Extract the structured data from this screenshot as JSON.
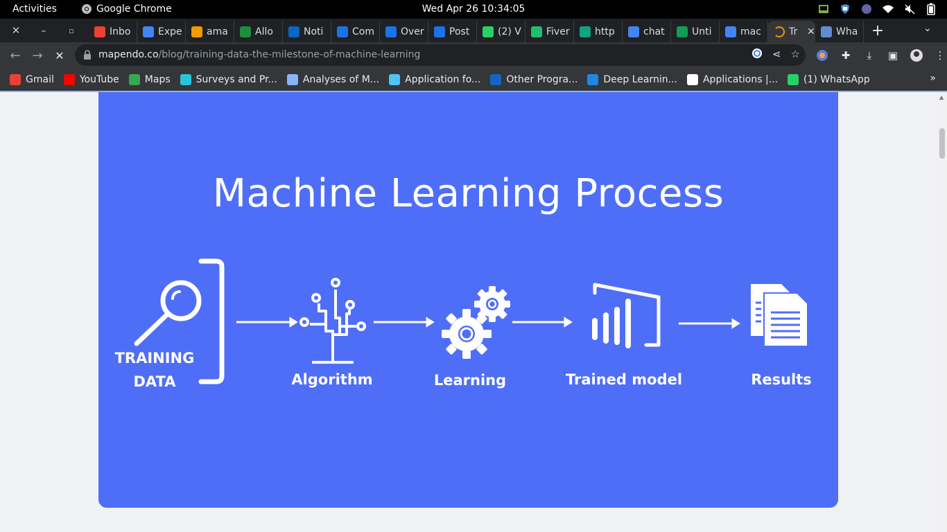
{
  "system": {
    "activities": "Activities",
    "app_name": "Google Chrome",
    "clock": "Wed Apr 26  10:34:05"
  },
  "tabs": [
    {
      "title": "Inbo",
      "icon": "gmail-icon",
      "color": "#ea4335"
    },
    {
      "title": "Expe",
      "icon": "gear-dots-icon",
      "color": "#4285f4"
    },
    {
      "title": "ama",
      "icon": "infinity-icon",
      "color": "#f29900"
    },
    {
      "title": "Allo",
      "icon": "chat-icon",
      "color": "#1e8e3e"
    },
    {
      "title": "Noti",
      "icon": "linkedin-icon",
      "color": "#0a66c2"
    },
    {
      "title": "Com",
      "icon": "play-icon",
      "color": "#1a73e8"
    },
    {
      "title": "Over",
      "icon": "play-icon",
      "color": "#1a73e8"
    },
    {
      "title": "Post",
      "icon": "play-icon",
      "color": "#1a73e8"
    },
    {
      "title": "(2) V",
      "icon": "whatsapp-icon",
      "color": "#25d366"
    },
    {
      "title": "Fiver",
      "icon": "fiverr-icon",
      "color": "#1dbf73"
    },
    {
      "title": "http",
      "icon": "openai-icon",
      "color": "#10a37f"
    },
    {
      "title": "chat",
      "icon": "google-icon",
      "color": "#4285f4"
    },
    {
      "title": "Unti",
      "icon": "sheets-icon",
      "color": "#0f9d58"
    },
    {
      "title": "mac",
      "icon": "google-icon",
      "color": "#4285f4"
    },
    {
      "title": "Tr",
      "icon": "loading-icon",
      "color": "#f29900",
      "active": true
    },
    {
      "title": "Wha",
      "icon": "puzzle-icon",
      "color": "#5f8dd3"
    }
  ],
  "toolbar": {
    "url_host": "mapendo.co",
    "url_path": "/blog/training-data-the-milestone-of-machine-learning"
  },
  "bookmarks": [
    {
      "label": "Gmail",
      "icon": "gmail-icon",
      "color": "#ea4335"
    },
    {
      "label": "YouTube",
      "icon": "youtube-icon",
      "color": "#ff0000"
    },
    {
      "label": "Maps",
      "icon": "maps-icon",
      "color": "#34a853"
    },
    {
      "label": "Surveys and Pr...",
      "icon": "pin-icon",
      "color": "#26c6da"
    },
    {
      "label": "Analyses of M...",
      "icon": "compass-icon",
      "color": "#8ab4f8"
    },
    {
      "label": "Application fo...",
      "icon": "circle-icon",
      "color": "#4fc3f7"
    },
    {
      "label": "Other Progra...",
      "icon": "flag-icon",
      "color": "#1565c0"
    },
    {
      "label": "Deep Learnin...",
      "icon": "bars-icon",
      "color": "#1e88e5"
    },
    {
      "label": "Applications |...",
      "icon": "amazon-icon",
      "color": "#ffffff"
    },
    {
      "label": "(1) WhatsApp",
      "icon": "whatsapp-icon",
      "color": "#25d366"
    }
  ],
  "bookmarks_more": "»",
  "hero": {
    "title": "Machine Learning Process",
    "background": "#4f6ef7",
    "steps": [
      {
        "label_line1": "TRAINING",
        "label_line2": "DATA",
        "icon": "magnifier-icon"
      },
      {
        "label": "Algorithm",
        "icon": "circuit-icon"
      },
      {
        "label": "Learning",
        "icon": "gears-icon"
      },
      {
        "label": "Trained model",
        "icon": "bar-chart-icon"
      },
      {
        "label": "Results",
        "icon": "documents-icon"
      }
    ]
  }
}
